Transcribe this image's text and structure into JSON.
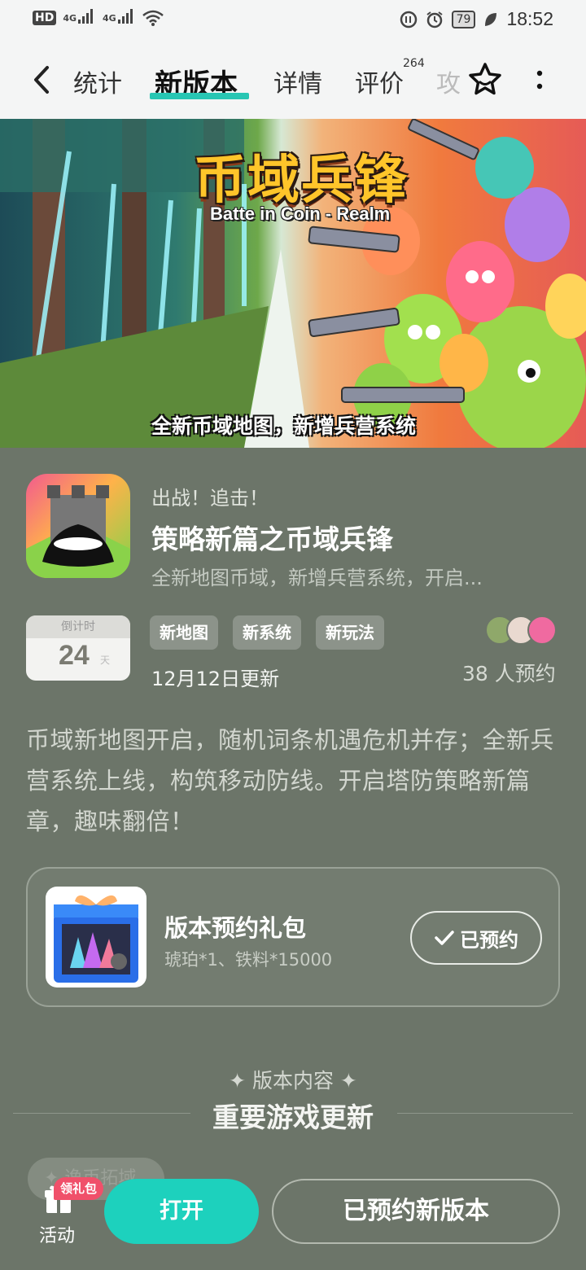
{
  "status_bar": {
    "hd_label": "HD",
    "net1": "4G",
    "net2": "4G",
    "battery": "79",
    "time": "18:52"
  },
  "nav": {
    "tabs": [
      {
        "label": "统计"
      },
      {
        "label": "新版本"
      },
      {
        "label": "详情"
      },
      {
        "label": "评价"
      },
      {
        "label": "攻"
      }
    ],
    "reviews_badge": "264",
    "active_tab": "新版本"
  },
  "banner": {
    "title": "币域兵锋",
    "subtitle": "Batte in Coin - Realm",
    "caption": "全新币域地图，新增兵营系统"
  },
  "game": {
    "eyebrow": "出战！追击！",
    "title": "策略新篇之币域兵锋",
    "description": "全新地图币域，新增兵营系统，开启..."
  },
  "countdown": {
    "label": "倒计时",
    "value": "24",
    "unit": "天"
  },
  "tags": [
    "新地图",
    "新系统",
    "新玩法"
  ],
  "update_date": "12月12日更新",
  "reserve_count": "38 人预约",
  "body_text": "币域新地图开启，随机词条机遇危机并存；全新兵营系统上线，构筑移动防线。开启塔防策略新篇章，趣味翻倍！",
  "gift": {
    "title": "版本预约礼包",
    "desc": "琥珀*1、铁料*15000",
    "button": "已预约"
  },
  "section": {
    "eyebrow": "✦ 版本内容 ✦",
    "title": "重要游戏更新",
    "chip": "✦ 逸币拓域"
  },
  "bottom": {
    "activity_label": "活动",
    "gift_badge": "领礼包",
    "open_button": "打开",
    "reserved_button": "已预约新版本"
  },
  "colors": {
    "accent": "#1dd1bd",
    "page_bg": "#6c7569",
    "badge": "#f0506a"
  }
}
